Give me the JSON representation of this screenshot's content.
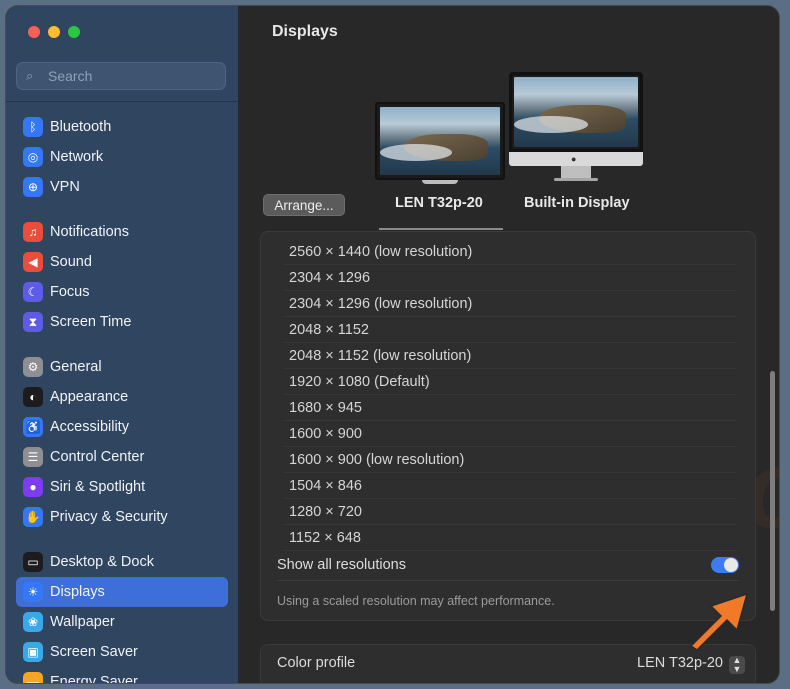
{
  "window": {
    "title": "Displays"
  },
  "search": {
    "placeholder": "Search"
  },
  "sidebar": {
    "items": [
      {
        "label": "Bluetooth",
        "icon": "bluetooth-icon",
        "glyph": "ᛒ",
        "color": "#3478f6"
      },
      {
        "label": "Network",
        "icon": "globe-icon",
        "glyph": "◎",
        "color": "#3478f6"
      },
      {
        "label": "VPN",
        "icon": "vpn-icon",
        "glyph": "⊕",
        "color": "#3478f6"
      },
      {
        "label": "Notifications",
        "icon": "bell-icon",
        "glyph": "♫",
        "color": "#eb4d3d"
      },
      {
        "label": "Sound",
        "icon": "speaker-icon",
        "glyph": "◀",
        "color": "#eb4d3d"
      },
      {
        "label": "Focus",
        "icon": "moon-icon",
        "glyph": "☾",
        "color": "#5e5ce6"
      },
      {
        "label": "Screen Time",
        "icon": "hourglass-icon",
        "glyph": "⧗",
        "color": "#5e5ce6"
      },
      {
        "label": "General",
        "icon": "gear-icon",
        "glyph": "⚙",
        "color": "#8e8e93"
      },
      {
        "label": "Appearance",
        "icon": "appearance-icon",
        "glyph": "◐",
        "color": "#1c1c1e"
      },
      {
        "label": "Accessibility",
        "icon": "accessibility-icon",
        "glyph": "♿",
        "color": "#3478f6"
      },
      {
        "label": "Control Center",
        "icon": "control-center-icon",
        "glyph": "☰",
        "color": "#8e8e93"
      },
      {
        "label": "Siri & Spotlight",
        "icon": "siri-icon",
        "glyph": "●",
        "color": "#7d3cf0"
      },
      {
        "label": "Privacy & Security",
        "icon": "hand-icon",
        "glyph": "✋",
        "color": "#3478f6"
      },
      {
        "label": "Desktop & Dock",
        "icon": "dock-icon",
        "glyph": "▭",
        "color": "#1c1c1e"
      },
      {
        "label": "Displays",
        "icon": "sun-icon",
        "glyph": "☀",
        "color": "#3478f6",
        "active": true
      },
      {
        "label": "Wallpaper",
        "icon": "flower-icon",
        "glyph": "❀",
        "color": "#39a7e8"
      },
      {
        "label": "Screen Saver",
        "icon": "screen-saver-icon",
        "glyph": "▣",
        "color": "#39a7e8"
      },
      {
        "label": "Energy Saver",
        "icon": "battery-icon",
        "glyph": "▬",
        "color": "#f5a623"
      }
    ]
  },
  "arrange_label": "Arrange...",
  "displays": [
    {
      "name": "LEN T32p-20"
    },
    {
      "name": "Built-in Display"
    }
  ],
  "resolutions": [
    "2560 × 1440 (low resolution)",
    "2304 × 1296",
    "2304 × 1296 (low resolution)",
    "2048 × 1152",
    "2048 × 1152 (low resolution)",
    "1920 × 1080 (Default)",
    "1680 × 945",
    "1600 × 900",
    "1600 × 900 (low resolution)",
    "1504 × 846",
    "1280 × 720",
    "1152 × 648"
  ],
  "show_all": {
    "label": "Show all resolutions",
    "on": true
  },
  "note": "Using a scaled resolution may affect performance.",
  "color_profile": {
    "label": "Color profile",
    "value": "LEN T32p-20"
  },
  "colors": {
    "accent": "#3e6fd8",
    "arrow": "#f07a2a"
  }
}
